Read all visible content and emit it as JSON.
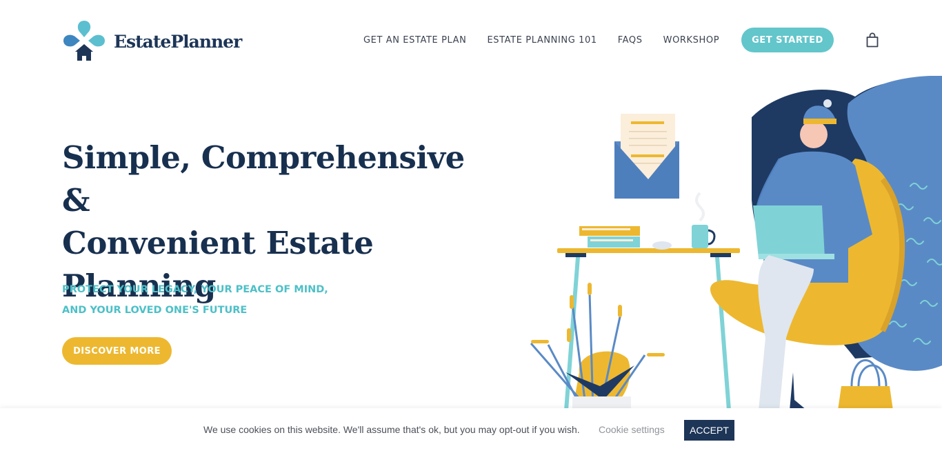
{
  "brand": {
    "name": "EstatePlanner",
    "colors": {
      "navy": "#1d3557",
      "teal": "#62c6cb",
      "yellow": "#edb830",
      "blue": "#5a8ac6"
    }
  },
  "nav": {
    "items": [
      {
        "label": "GET AN ESTATE PLAN"
      },
      {
        "label": "ESTATE PLANNING 101"
      },
      {
        "label": "FAQS"
      },
      {
        "label": "WORKSHOP"
      }
    ],
    "cta_label": "GET STARTED",
    "cart_icon": "shopping-bag-icon"
  },
  "hero": {
    "title_lines": [
      "Simple, Comprehensive &",
      "Convenient Estate",
      "Planning"
    ],
    "subtitle_lines": [
      "PROTECT YOUR LEGACY, YOUR PEACE OF MIND,",
      "AND YOUR LOVED ONE'S FUTURE"
    ],
    "button_label": "DISCOVER MORE"
  },
  "cookie_bar": {
    "message": "We use cookies on this website. We'll assume that's ok, but you may opt-out if you wish.",
    "settings_label": "Cookie settings",
    "accept_label": "ACCEPT"
  }
}
